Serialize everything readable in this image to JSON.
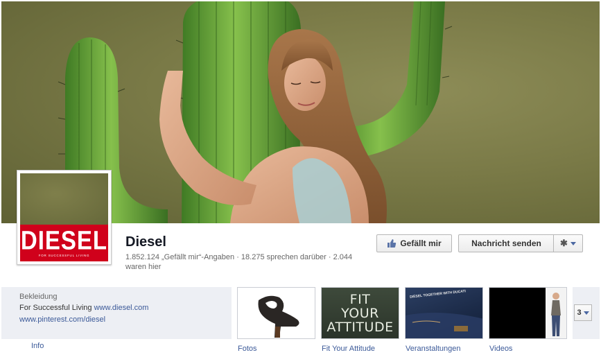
{
  "page": {
    "name": "Diesel",
    "stats": "1.852.124 „Gefällt mir“-Angaben · 18.275 sprechen darüber · 2.044 waren hier"
  },
  "logo": {
    "word": "DIESEL",
    "tagline": "FOR SUCCESSFUL LIVING"
  },
  "buttons": {
    "like": "Gefällt mir",
    "message": "Nachricht senden"
  },
  "info": {
    "category": "Bekleidung",
    "tagline": "For Successful Living",
    "website": "www.diesel.com",
    "pinterest": "www.pinterest.com/diesel",
    "label": "Info"
  },
  "apps": [
    {
      "label": "Fotos"
    },
    {
      "label": "Fit Your Attitude",
      "tile_text": [
        "FIT",
        "YOUR",
        "ATTITUDE"
      ]
    },
    {
      "label": "Veranstaltungen",
      "tile_text": "DIESEL TOGETHER WITH DUCATI"
    },
    {
      "label": "Videos"
    }
  ],
  "more": {
    "count": "3"
  },
  "colors": {
    "link": "#3b5998",
    "brand_red": "#d0011b",
    "info_bg": "#edeff4",
    "cover_olive": "#7a7a47",
    "cactus_green": "#6aa83a"
  }
}
